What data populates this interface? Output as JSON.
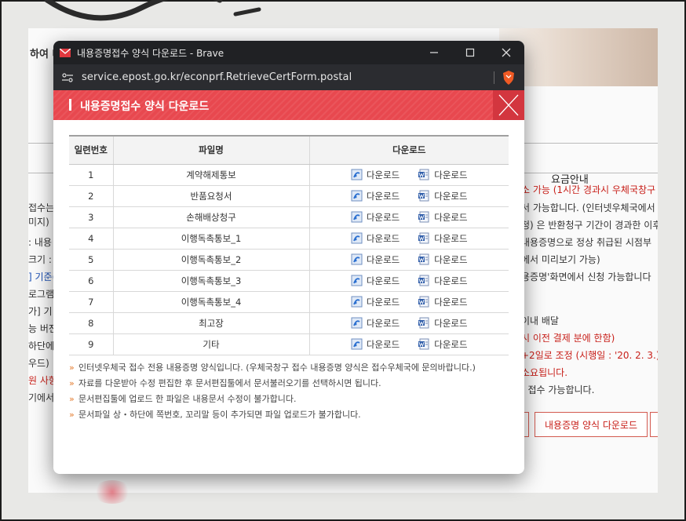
{
  "background": {
    "left_header": "하여 내",
    "tab_label": "요금안내",
    "left_lines": [
      "접수는",
      "미지)",
      ": 내용",
      "크기 :",
      "] 기준(",
      "로그램",
      "가] 기",
      "능 버전",
      "하단에",
      "우드)",
      "원 사항",
      "기에서"
    ],
    "right_lines": [
      "소 가능 (1시간 경과시 우체국창구",
      "서 가능합니다. (인터넷우체국에서",
      "청) 은 반환청구 기간이 경과한 이후",
      "내용증명으로 정상 취급된 시점부",
      "에서 미리보기 가능)",
      "용증명'화면에서 신청 가능합니다",
      "이내 배달",
      "시 이전 결제 분에 한함)",
      "+2일로 조정 (시행일 : '20. 2. 3.)",
      "소요됩니다.",
      "] 접수 가능합니다."
    ],
    "button_label": "내용증명 양식 다운로드"
  },
  "window": {
    "title": "내용증명접수 양식 다운로드 - Brave",
    "url": "service.epost.go.kr/econprf.RetrieveCertForm.postal",
    "banner_title": "내용증명접수 양식 다운로드"
  },
  "table": {
    "headers": [
      "일련번호",
      "파일명",
      "다운로드"
    ],
    "download_label": "다운로드",
    "rows": [
      {
        "no": "1",
        "name": "계약해제통보"
      },
      {
        "no": "2",
        "name": "반품요청서"
      },
      {
        "no": "3",
        "name": "손해배상청구"
      },
      {
        "no": "4",
        "name": "이행독촉통보_1"
      },
      {
        "no": "5",
        "name": "이행독촉통보_2"
      },
      {
        "no": "6",
        "name": "이행독촉통보_3"
      },
      {
        "no": "7",
        "name": "이행독촉통보_4"
      },
      {
        "no": "8",
        "name": "최고장"
      },
      {
        "no": "9",
        "name": "기타"
      }
    ]
  },
  "notes": [
    "인터넷우체국 접수 전용 내용증명 양식입니다. (우체국창구 접수 내용증명 양식은 접수우체국에 문의바랍니다.)",
    "자료를 다운받아 수정 편집한 후 문서편집툴에서 문서불러오기를 선택하시면 됩니다.",
    "문서편집툴에 업로드 한 파일은 내용문서 수정이 불가합니다.",
    "문서파일 상・하단에 쪽번호, 꼬리말 등이 추가되면 파일 업로드가 불가합니다."
  ],
  "colors": {
    "banner_red": "#e8484f",
    "note_bullet": "#e37a2c",
    "titlebar": "#202124"
  }
}
